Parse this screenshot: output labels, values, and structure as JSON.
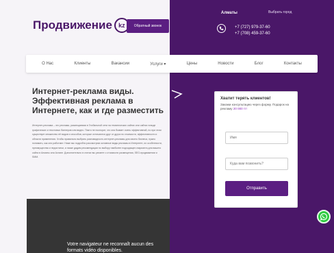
{
  "header": {
    "logo_text": "Продвижение",
    "logo_badge": "kz",
    "callback_label": "Обратный звонок",
    "city": "Алматы",
    "city_link": "Выбрать город",
    "phones": [
      "+7 (727) 979-37-60",
      "+7 (708) 459-37-60"
    ]
  },
  "nav": {
    "items": [
      "О Нас",
      "Клиенты",
      "Вакансии",
      "Услуги ▾",
      "Цены",
      "Новости",
      "Блог",
      "Контакты"
    ]
  },
  "main": {
    "headline": "Интернет-реклама виды. Эффективная реклама в Интернете, как и где разместить",
    "article": "Интернет-реклама – это реклама, размещаемая в Глобальной сети на тематических сайтах или сайтах в виде графических и текстовых баннеров или видео. Пикто не поспорит, что она бывает очень эффективной, но при этом существует множество её видов и способов, которые отличаются друг от друга по стоимости, эффективности и области применения. Чтобы правильно выбрать разновидность интернет-рекламы для своего бизнеса, нужно понимать, как они работают. Ниже мы подробно рассмотрим основные виды рекламы в Интернете, их особенности, преимущества и недостатки, а также дадим рекомендации по выбору наиболее подходящего варианта для вашего сайта в Алматы или Астане. Дополнительно в статье вы узнаете о стоимости размещения, SEO-продвижении и SMM."
  },
  "form": {
    "title": "Хватит терять клиентов!",
    "text_prefix": "Закажи консультацию через форму. Подарок на рекламу",
    "text_highlight": "20 000 тг!",
    "name_placeholder": "Имя",
    "phone_placeholder": "Куда вам позвонить?",
    "submit_label": "Отправить"
  },
  "video": {
    "message": "Votre navigateur ne reconnaît aucun des formats vidéo disponibles."
  },
  "colors": {
    "brand": "#4a1768",
    "accent": "#5b1e82",
    "whatsapp": "#2ecc40"
  }
}
